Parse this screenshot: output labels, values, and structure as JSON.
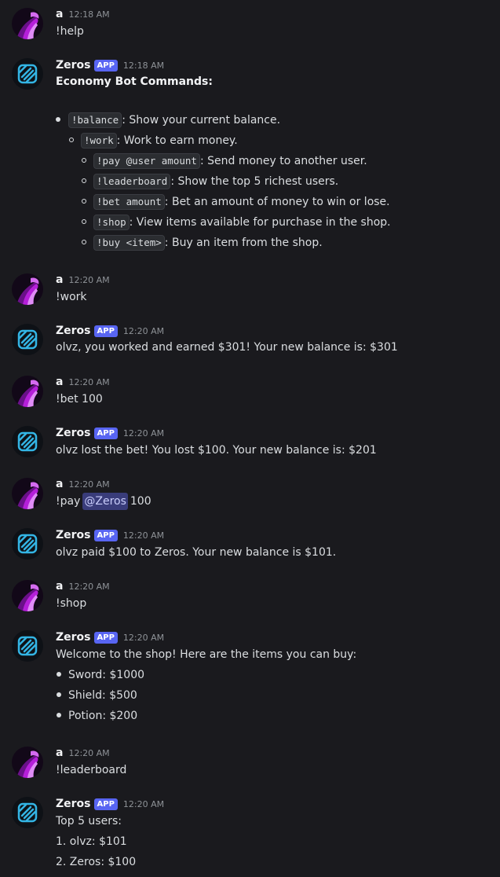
{
  "users": {
    "a": {
      "name": "a"
    },
    "zeros": {
      "name": "Zeros",
      "badge": "APP"
    }
  },
  "colors": {
    "background": "#1a1a1e",
    "app_badge": "#5865f2",
    "mention_bg": "#393c7a",
    "bot_logo": "#33b5e5",
    "user_avatar_purple": "#a020c8"
  },
  "messages": [
    {
      "author": "a",
      "time": "12:18 AM",
      "text": "!help"
    },
    {
      "author": "Zeros",
      "badge": "APP",
      "time": "12:18 AM",
      "heading": "Economy Bot Commands:",
      "commands": [
        {
          "cmd": "!balance",
          "desc": ": Show your current balance."
        },
        {
          "cmd": "!work",
          "desc": ": Work to earn money."
        },
        {
          "cmd": "!pay @user amount",
          "desc": ": Send money to another user."
        },
        {
          "cmd": "!leaderboard",
          "desc": ": Show the top 5 richest users."
        },
        {
          "cmd": "!bet amount",
          "desc": ": Bet an amount of money to win or lose."
        },
        {
          "cmd": "!shop",
          "desc": ": View items available for purchase in the shop."
        },
        {
          "cmd": "!buy <item>",
          "desc": ": Buy an item from the shop."
        }
      ]
    },
    {
      "author": "a",
      "time": "12:20 AM",
      "text": "!work"
    },
    {
      "author": "Zeros",
      "badge": "APP",
      "time": "12:20 AM",
      "text": "olvz, you worked and earned $301! Your new balance is: $301"
    },
    {
      "author": "a",
      "time": "12:20 AM",
      "text": "!bet 100"
    },
    {
      "author": "Zeros",
      "badge": "APP",
      "time": "12:20 AM",
      "text": "olvz lost the bet! You lost $100. Your new balance is: $201"
    },
    {
      "author": "a",
      "time": "12:20 AM",
      "text_before": "!pay",
      "mention": "@Zeros",
      "text_after": "100"
    },
    {
      "author": "Zeros",
      "badge": "APP",
      "time": "12:20 AM",
      "text": "olvz paid $100 to Zeros. Your new balance is $101."
    },
    {
      "author": "a",
      "time": "12:20 AM",
      "text": "!shop"
    },
    {
      "author": "Zeros",
      "badge": "APP",
      "time": "12:20 AM",
      "text": "Welcome to the shop! Here are the items you can buy:",
      "items": [
        "Sword: $1000",
        "Shield: $500",
        "Potion: $200"
      ]
    },
    {
      "author": "a",
      "time": "12:20 AM",
      "text": "!leaderboard"
    },
    {
      "author": "Zeros",
      "badge": "APP",
      "time": "12:20 AM",
      "text": "Top 5 users:",
      "lines": [
        "1. olvz: $101",
        "2. Zeros: $100"
      ]
    }
  ]
}
